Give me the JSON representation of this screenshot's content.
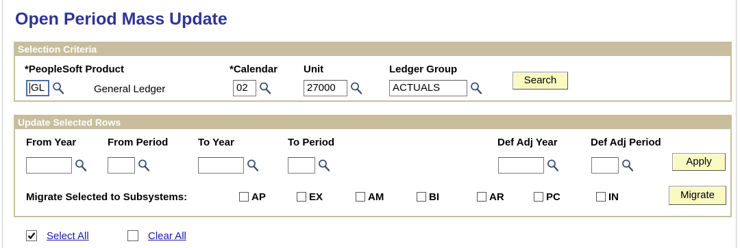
{
  "page": {
    "title": "Open Period Mass Update"
  },
  "selection_criteria": {
    "header": "Selection Criteria",
    "product_label": "*PeopleSoft Product",
    "product_value": "GL",
    "product_description": "General Ledger",
    "calendar_label": "*Calendar",
    "calendar_value": "02",
    "unit_label": "Unit",
    "unit_value": "27000",
    "ledger_group_label": "Ledger Group",
    "ledger_group_value": "ACTUALS",
    "search_button": "Search"
  },
  "update_rows": {
    "header": "Update Selected Rows",
    "from_year_label": "From Year",
    "from_year_value": "",
    "from_period_label": "From Period",
    "from_period_value": "",
    "to_year_label": "To Year",
    "to_year_value": "",
    "to_period_label": "To Period",
    "to_period_value": "",
    "def_adj_year_label": "Def Adj Year",
    "def_adj_year_value": "",
    "def_adj_period_label": "Def Adj Period",
    "def_adj_period_value": "",
    "apply_button": "Apply",
    "migrate_label": "Migrate Selected to Subsystems:",
    "subsystems": [
      {
        "label": "AP",
        "checked": false
      },
      {
        "label": "EX",
        "checked": false
      },
      {
        "label": "AM",
        "checked": false
      },
      {
        "label": "BI",
        "checked": false
      },
      {
        "label": "AR",
        "checked": false
      },
      {
        "label": "PC",
        "checked": false
      },
      {
        "label": "IN",
        "checked": false
      }
    ],
    "migrate_button": "Migrate"
  },
  "footer": {
    "select_all": "Select All",
    "clear_all": "Clear All"
  },
  "colors": {
    "title": "#2e3593",
    "group_header_bg": "#c8bd9d",
    "button_bg": "#fafac0",
    "link": "#1a1aa6"
  },
  "icons": {
    "lookup": "magnifier-icon",
    "checked": "checkmark-icon"
  }
}
